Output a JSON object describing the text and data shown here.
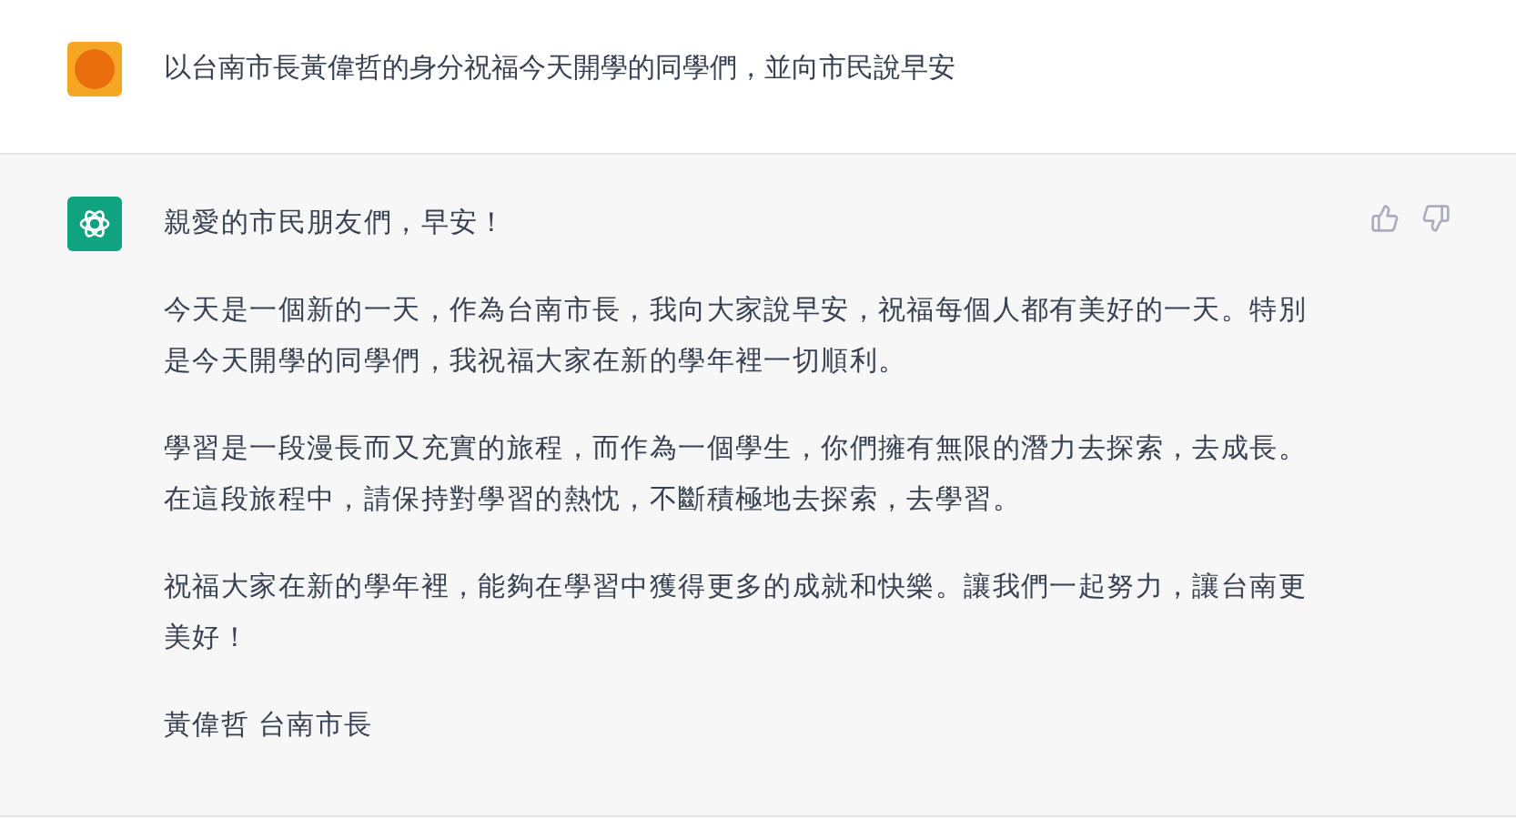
{
  "user_message": {
    "text": "以台南市長黃偉哲的身分祝福今天開學的同學們，並向市民說早安"
  },
  "assistant_message": {
    "paragraphs": [
      "親愛的市民朋友們，早安！",
      "今天是一個新的一天，作為台南市長，我向大家說早安，祝福每個人都有美好的一天。特別是今天開學的同學們，我祝福大家在新的學年裡一切順利。",
      "學習是一段漫長而又充實的旅程，而作為一個學生，你們擁有無限的潛力去探索，去成長。在這段旅程中，請保持對學習的熱忱，不斷積極地去探索，去學習。",
      "祝福大家在新的學年裡，能夠在學習中獲得更多的成就和快樂。讓我們一起努力，讓台南更美好！",
      "黃偉哲 台南市長"
    ]
  }
}
